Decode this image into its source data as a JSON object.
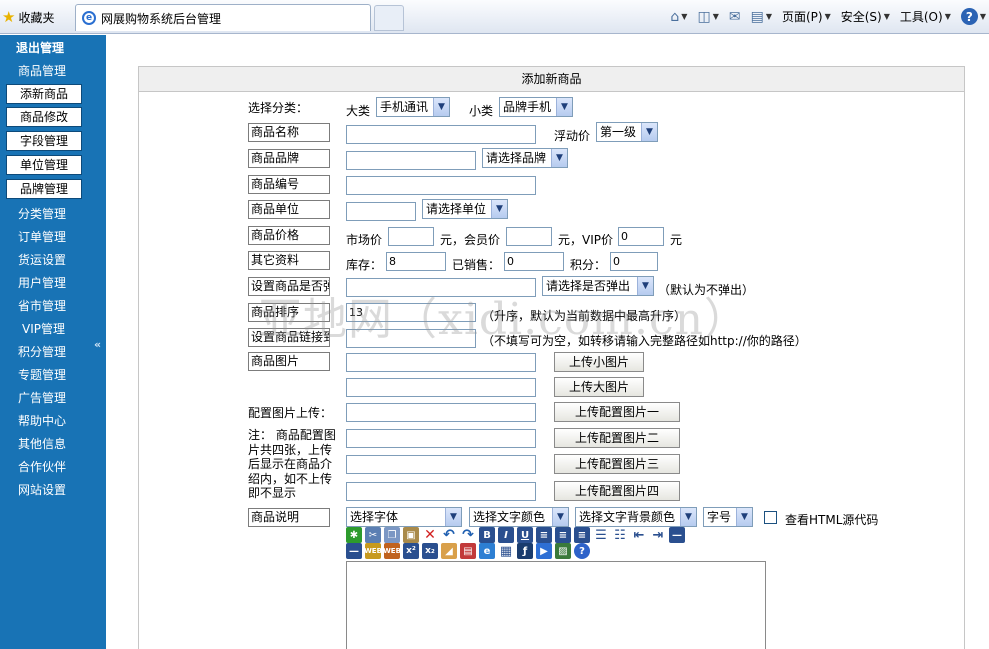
{
  "browser": {
    "favorites_label": "收藏夹",
    "tab_title": "网展购物系统后台管理",
    "tools": {
      "page": "页面(P)",
      "safety": "安全(S)",
      "tools": "工具(O)"
    }
  },
  "sidebar": {
    "logout": "退出管理",
    "items": [
      "商品管理",
      "添新商品",
      "商品修改",
      "字段管理",
      "单位管理",
      "品牌管理",
      "分类管理",
      "订单管理",
      "货运设置",
      "用户管理",
      "省市管理",
      "VIP管理",
      "积分管理",
      "专题管理",
      "广告管理",
      "帮助中心",
      "其他信息",
      "合作伙伴",
      "网站设置"
    ]
  },
  "form": {
    "title": "添加新商品",
    "category": {
      "label": "选择分类：",
      "big_label": "大类",
      "big_value": "手机通讯",
      "small_label": "小类",
      "small_value": "品牌手机"
    },
    "name": {
      "label": "商品名称",
      "float_label": "浮动价",
      "float_value": "第一级"
    },
    "brand": {
      "label": "商品品牌",
      "select": "请选择品牌"
    },
    "code": {
      "label": "商品编号"
    },
    "unit": {
      "label": "商品单位",
      "select": "请选择单位"
    },
    "price": {
      "label": "商品价格",
      "market_label": "市场价",
      "yuan1": "元，会员价",
      "yuan2": "元，VIP价",
      "vip_value": "0",
      "yuan3": "元"
    },
    "other": {
      "label": "其它资料",
      "stock_label": "库存：",
      "stock_value": "8",
      "sold_label": "已销售：",
      "sold_value": "0",
      "points_label": "积分：",
      "points_value": "0"
    },
    "popup": {
      "label": "设置商品是否弹",
      "select": "请选择是否弹出",
      "note": "（默认为不弹出）"
    },
    "sort": {
      "label": "商品排序",
      "value": "13",
      "note": "（升序，默认为当前数据中最高升序）"
    },
    "link": {
      "label": "设置商品链接到",
      "note": "（不填写可为空，如转移请输入完整路径如http://你的路径）"
    },
    "image": {
      "label": "商品图片",
      "small_btn": "上传小图片",
      "big_btn": "上传大图片"
    },
    "config": {
      "label": "配置图片上传：",
      "note": [
        "注：  商品配置图",
        "片共四张，上传",
        "后显示在商品介",
        "绍内，如不上传",
        "即不显示"
      ],
      "btn1": "上传配置图片一",
      "btn2": "上传配置图片二",
      "btn3": "上传配置图片三",
      "btn4": "上传配置图片四"
    },
    "desc": {
      "label": "商品说明",
      "font": "选择字体",
      "color": "选择文字颜色",
      "bgcolor": "选择文字背景颜色",
      "size": "字号",
      "html_label": "查看HTML源代码"
    }
  },
  "watermark": "亚地网（xidi.com.cn）"
}
